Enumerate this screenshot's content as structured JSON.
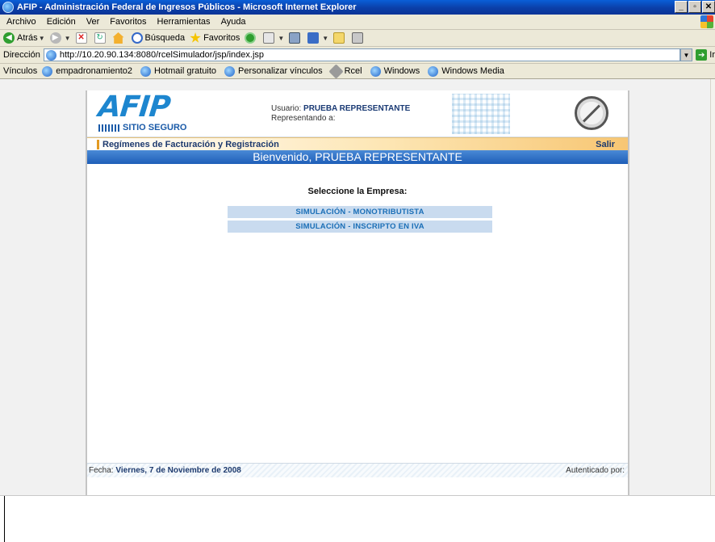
{
  "window": {
    "title": "AFIP - Administración Federal de Ingresos Públicos - Microsoft Internet Explorer",
    "min_label": "_",
    "max_label": "▫",
    "close_label": "✕"
  },
  "menu": [
    "Archivo",
    "Edición",
    "Ver",
    "Favoritos",
    "Herramientas",
    "Ayuda"
  ],
  "toolbar": {
    "back": "Atrás",
    "search": "Búsqueda",
    "favorites": "Favoritos"
  },
  "address": {
    "label": "Dirección",
    "url": "http://10.20.90.134:8080/rcelSimulador/jsp/index.jsp",
    "go": "Ir"
  },
  "links": {
    "label": "Vínculos",
    "items": [
      "empadronamiento2",
      "Hotmail gratuito",
      "Personalizar vínculos",
      "Rcel",
      "Windows",
      "Windows Media"
    ]
  },
  "page": {
    "logo_text": "AFIP",
    "secure_label": "SITIO SEGURO",
    "user_label": "Usuario:",
    "user_name": "PRUEBA REPRESENTANTE",
    "representing_label": "Representando a:",
    "section_title": "Regímenes de Facturación y Registración",
    "logout": "Salir",
    "welcome": "Bienvenido, PRUEBA REPRESENTANTE",
    "select_title": "Seleccione la Empresa:",
    "companies": [
      "SIMULACIÓN - MONOTRIBUTISTA",
      "SIMULACIÓN - INSCRIPTO EN IVA"
    ],
    "date_label": "Fecha:",
    "date_value": "Viernes, 7 de Noviembre de 2008",
    "auth_label": "Autenticado por:"
  }
}
